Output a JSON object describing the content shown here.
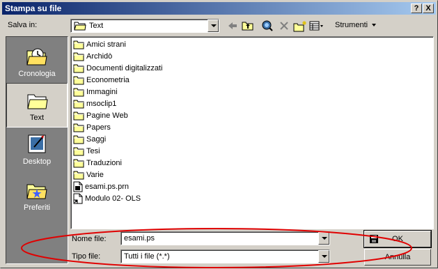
{
  "window": {
    "title": "Stampa su file"
  },
  "titlebar_buttons": {
    "help": "?",
    "close": "X"
  },
  "toolbar": {
    "lookin_label": "Salva in:",
    "lookin_value": "Text",
    "tools_label": "Strumenti"
  },
  "places": [
    {
      "label": "Cronologia",
      "icon": "history-folder-icon",
      "selected": false
    },
    {
      "label": "Text",
      "icon": "folder-icon",
      "selected": true
    },
    {
      "label": "Desktop",
      "icon": "desktop-icon",
      "selected": false
    },
    {
      "label": "Preferiti",
      "icon": "favorites-folder-icon",
      "selected": false
    }
  ],
  "files": [
    {
      "name": "Amici strani",
      "type": "folder"
    },
    {
      "name": "Archidò",
      "type": "folder"
    },
    {
      "name": "Documenti digitalizzati",
      "type": "folder"
    },
    {
      "name": "Econometria",
      "type": "folder"
    },
    {
      "name": "Immagini",
      "type": "folder"
    },
    {
      "name": "msoclip1",
      "type": "folder"
    },
    {
      "name": "Pagine Web",
      "type": "folder"
    },
    {
      "name": "Papers",
      "type": "folder"
    },
    {
      "name": "Saggi",
      "type": "folder"
    },
    {
      "name": "Tesi",
      "type": "folder"
    },
    {
      "name": "Traduzioni",
      "type": "folder"
    },
    {
      "name": "Varie",
      "type": "folder"
    },
    {
      "name": "esami.ps.prn",
      "type": "file"
    },
    {
      "name": "Modulo 02- OLS",
      "type": "shortcut"
    }
  ],
  "form": {
    "filename_label": "Nome file:",
    "filename_value": "esami.ps",
    "filetype_label": "Tipo file:",
    "filetype_value": "Tutti i file (*.*)",
    "ok_label": "OK",
    "cancel_label": "Annulla"
  },
  "annotation": {
    "color": "#e00000"
  }
}
